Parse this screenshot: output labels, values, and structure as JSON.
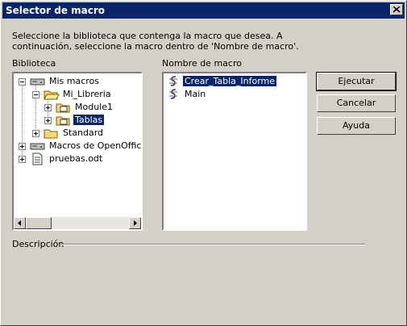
{
  "window": {
    "title": "Selector de macro"
  },
  "intro_text": "Seleccione la biblioteca que contenga la macro que desea. A continuación, seleccione la macro dentro de 'Nombre de macro'.",
  "library_label": "Biblioteca",
  "macro_label": "Nombre de macro",
  "tree": {
    "items": [
      {
        "label": "Mis macros"
      },
      {
        "label": "Mi_Libreria"
      },
      {
        "label": "Module1"
      },
      {
        "label": "Tablas"
      },
      {
        "label": "Standard"
      },
      {
        "label": "Macros de OpenOffice.org"
      },
      {
        "label": "pruebas.odt"
      }
    ]
  },
  "macros": [
    {
      "label": "Crear_Tabla_Informe"
    },
    {
      "label": "Main"
    }
  ],
  "buttons": {
    "run": "Ejecutar",
    "cancel": "Cancelar",
    "help": "Ayuda"
  },
  "description_label": "Descripción"
}
